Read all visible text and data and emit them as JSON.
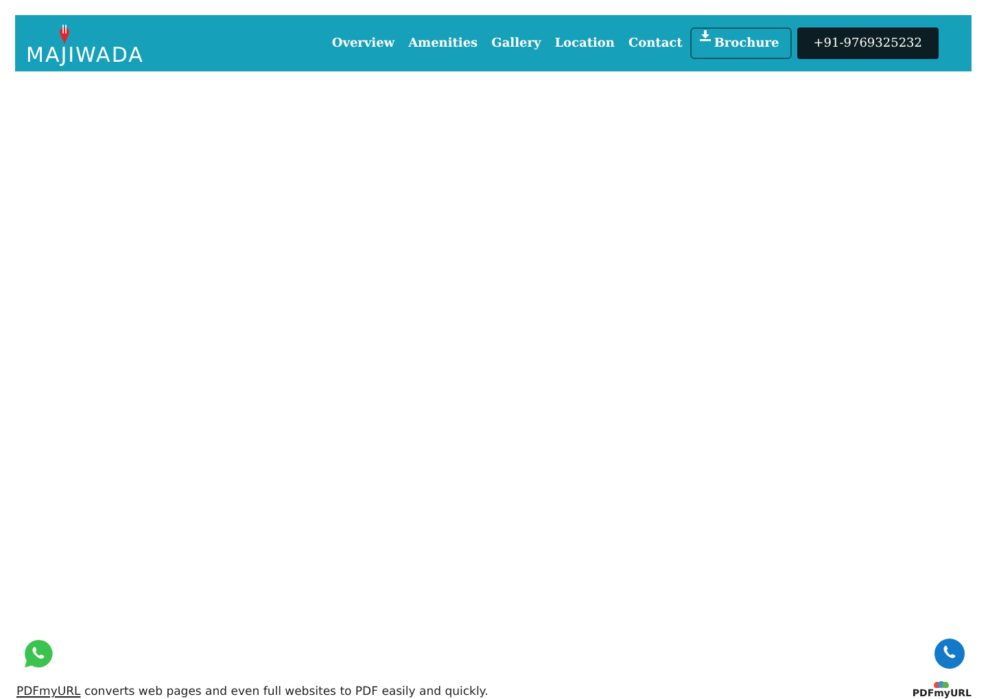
{
  "header": {
    "logo": "MAJIWADA",
    "nav": [
      {
        "label": "Overview"
      },
      {
        "label": "Amenities"
      },
      {
        "label": "Gallery"
      },
      {
        "label": "Location"
      },
      {
        "label": "Contact"
      }
    ],
    "brochure_button": "Brochure",
    "phone_button": "+91-9769325232"
  },
  "footer": {
    "link": "PDFmyURL",
    "text": "converts web pages and even full websites to PDF easily and quickly.",
    "logo": "PDFmyURL"
  }
}
